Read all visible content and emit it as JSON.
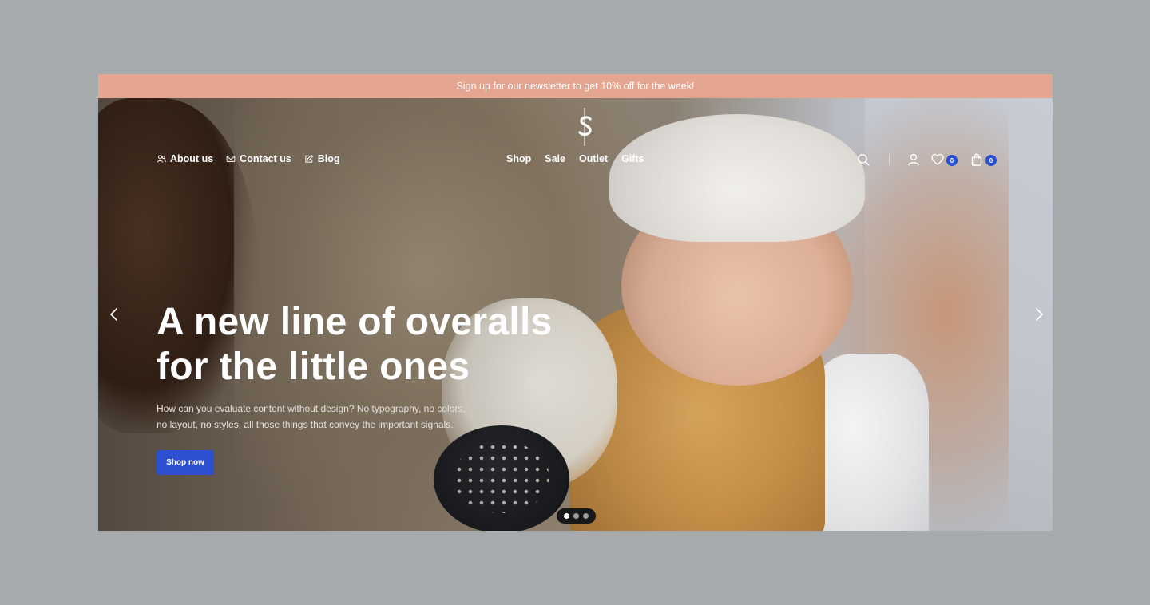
{
  "announcement": "Sign up for our newsletter to get 10% off for the week!",
  "nav_left": [
    {
      "label": "About us",
      "icon": "users-icon"
    },
    {
      "label": "Contact us",
      "icon": "mail-icon"
    },
    {
      "label": "Blog",
      "icon": "edit-icon"
    }
  ],
  "nav_center": [
    "Shop",
    "Sale",
    "Outlet",
    "Gifts"
  ],
  "header_right": {
    "wishlist_count": "0",
    "cart_count": "0"
  },
  "hero": {
    "title_line1": "A new line of overalls",
    "title_line2": "for the little ones",
    "desc_line1": "How can you evaluate content without design? No typography, no colors,",
    "desc_line2": "no layout, no styles, all those things that convey the important signals.",
    "cta": "Shop now"
  },
  "slider": {
    "total": 3,
    "active": 1
  },
  "colors": {
    "announcement_bg": "#e4a591",
    "accent": "#2e4fd2",
    "page_bg": "#a6aaac"
  }
}
